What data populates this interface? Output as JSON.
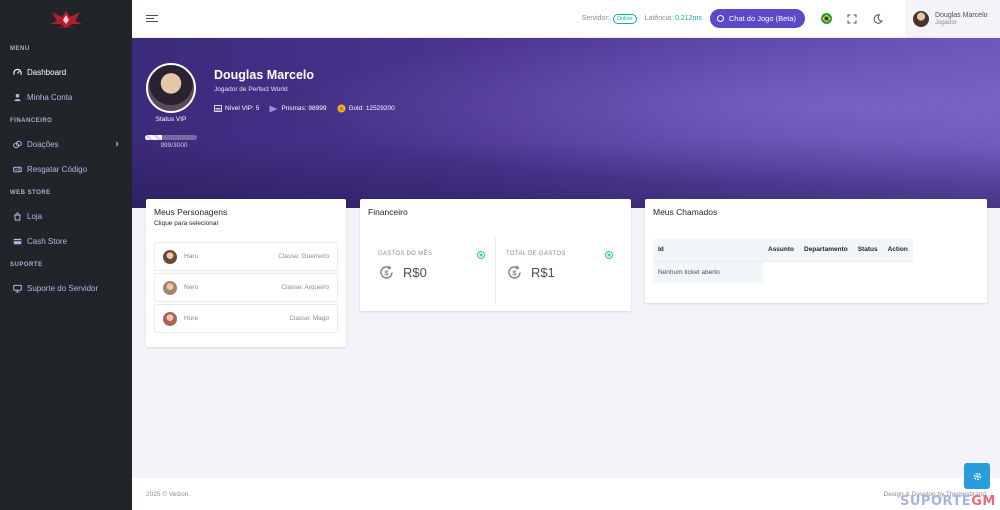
{
  "sidebar": {
    "sections": [
      {
        "title": "MENU",
        "items": [
          {
            "label": "Dashboard",
            "icon": "dashboard-icon",
            "active": true
          },
          {
            "label": "Minha Conta",
            "icon": "user-icon"
          }
        ]
      },
      {
        "title": "FINANCEIRO",
        "items": [
          {
            "label": "Doações",
            "icon": "donation-icon",
            "chevron": true
          },
          {
            "label": "Resgatar Código",
            "icon": "ticket-icon"
          }
        ]
      },
      {
        "title": "WEB STORE",
        "items": [
          {
            "label": "Loja",
            "icon": "shop-icon"
          },
          {
            "label": "Cash Store",
            "icon": "card-icon"
          }
        ]
      },
      {
        "title": "SUPORTE",
        "items": [
          {
            "label": "Suporte do Servidor",
            "icon": "monitor-icon"
          }
        ]
      }
    ]
  },
  "topbar": {
    "server_label": "Servidor:",
    "server_status": "Online",
    "latency_label": "Latência:",
    "latency_value": "0.212ms",
    "chat_button": "Chat do Jogo (Beta)",
    "user_name": "Douglas Marcelo",
    "user_role": "Jogador"
  },
  "profile": {
    "name": "Douglas Marcelo",
    "subtitle": "Jogador de Perfect World",
    "status": "Status VIP",
    "vip_progress": "999/3000",
    "vip_fraction": 0.333,
    "vip_level": "Nível VIP: 5",
    "prismas": "Prismas: 98999",
    "gold": "Gold: 12529200"
  },
  "characters": {
    "title": "Meus Personagens",
    "subtitle": "Clique para selecionar",
    "items": [
      {
        "name": "Haru",
        "class": "Classe: Guerreiro",
        "color": "#6b4a3a"
      },
      {
        "name": "Nero",
        "class": "Classe: Arqueiro",
        "color": "#a0886a"
      },
      {
        "name": "Hure",
        "class": "Classe: Mago",
        "color": "#b0615a"
      }
    ]
  },
  "financeiro": {
    "title": "Financeiro",
    "month_label": "GASTOS DO MÊS",
    "month_value": "R$0",
    "total_label": "TOTAL DE GASTOS",
    "total_value": "R$1"
  },
  "tickets": {
    "title": "Meus Chamados",
    "columns": [
      "Id",
      "Assunto",
      "Departamento",
      "Status",
      "Action"
    ],
    "empty": "Nenhum ticket aberto"
  },
  "footer": {
    "left": "2025 © Velzon.",
    "right": "Design & Develop by Themesbrand"
  },
  "watermark": {
    "a": "SUPORTE",
    "b": "GM"
  },
  "colors": {
    "sidebar": "#212529",
    "accent": "#5a49c8",
    "success": "#0ab39c",
    "fab": "#299cdb"
  }
}
